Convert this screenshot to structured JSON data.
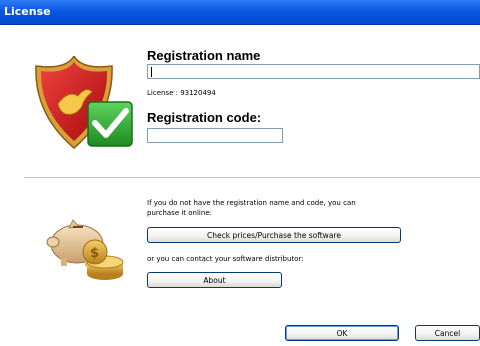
{
  "window": {
    "title": "License"
  },
  "registration": {
    "name_label": "Registration name",
    "name_value": "",
    "license_text": "License : 93120494",
    "code_label": "Registration code:",
    "code_value": ""
  },
  "purchase": {
    "info_line1": "If you do not have the registration name and code, you can",
    "info_line2": "purchase it online:",
    "purchase_button": "Check prices/Purchase the software",
    "distributor_text": "or you can contact your software distributor:",
    "about_button": "About"
  },
  "footer": {
    "ok_button": "OK",
    "cancel_button": "Cancel"
  },
  "icons": {
    "registration": "shield-checkmark-icon",
    "purchase": "piggy-bank-coins-icon"
  },
  "colors": {
    "titlebar": "#0a58e0",
    "shield_red": "#cc1515",
    "check_green": "#27a22b",
    "gold": "#d9a03a"
  }
}
